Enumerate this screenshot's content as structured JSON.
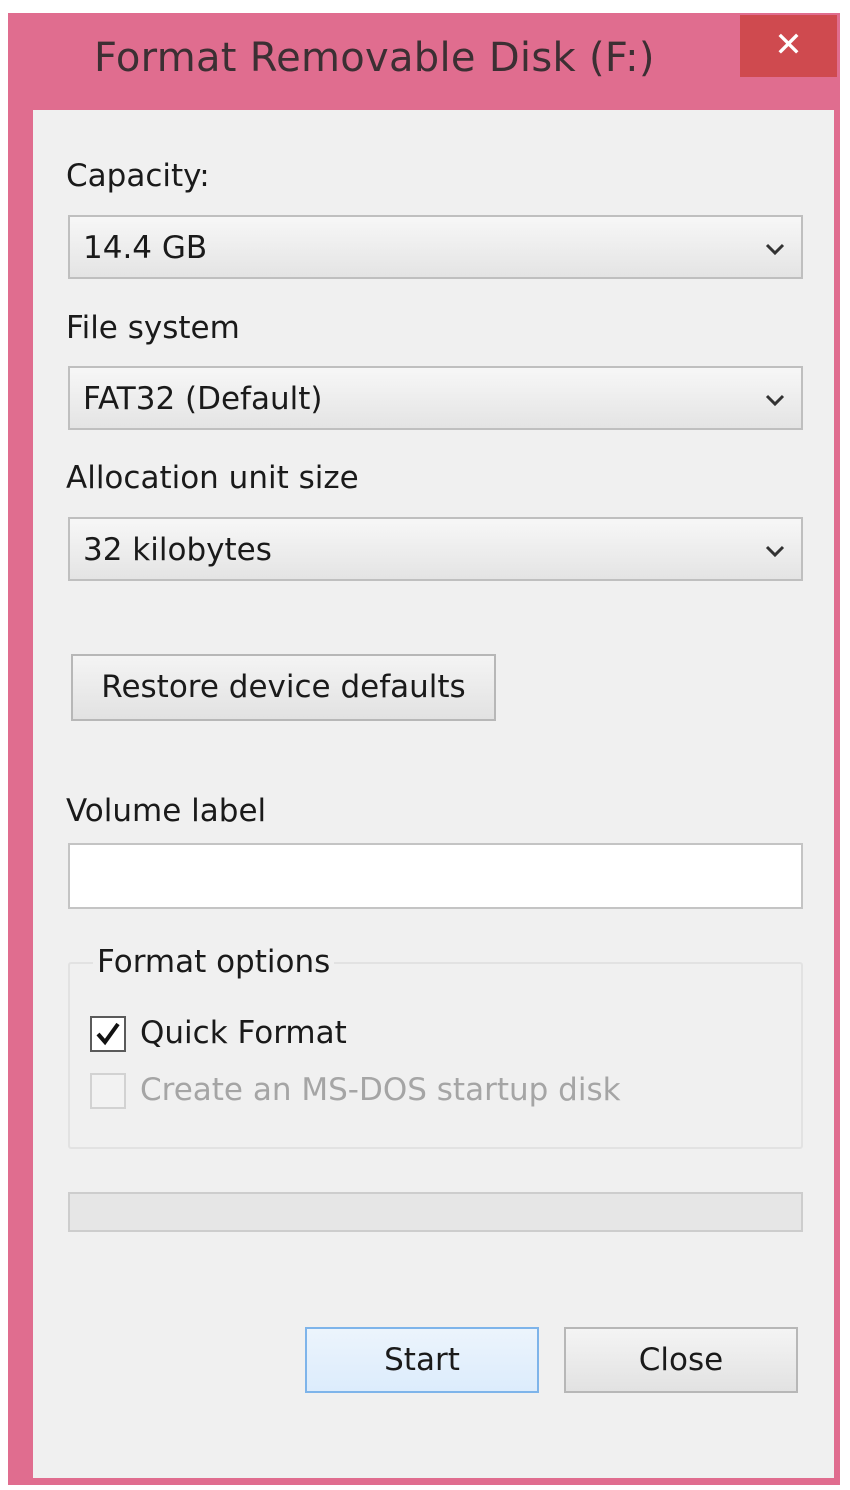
{
  "window": {
    "title": "Format Removable Disk (F:)",
    "close_icon": "close-icon",
    "accent_color": "#e06d8f"
  },
  "capacity": {
    "label": "Capacity:",
    "value": "14.4 GB"
  },
  "file_system": {
    "label": "File system",
    "value": "FAT32 (Default)"
  },
  "allocation_unit_size": {
    "label": "Allocation unit size",
    "value": "32 kilobytes"
  },
  "restore_defaults_label": "Restore device defaults",
  "volume_label": {
    "label": "Volume label",
    "value": ""
  },
  "format_options": {
    "title": "Format options",
    "quick_format": {
      "label": "Quick Format",
      "checked": true
    },
    "msdos_startup": {
      "label": "Create an MS-DOS startup disk",
      "checked": false,
      "disabled": true
    }
  },
  "progress": {
    "value": 0
  },
  "buttons": {
    "start": "Start",
    "close": "Close"
  },
  "icons": {
    "dropdown": "chevron-down-icon",
    "check": "checkmark-icon"
  }
}
